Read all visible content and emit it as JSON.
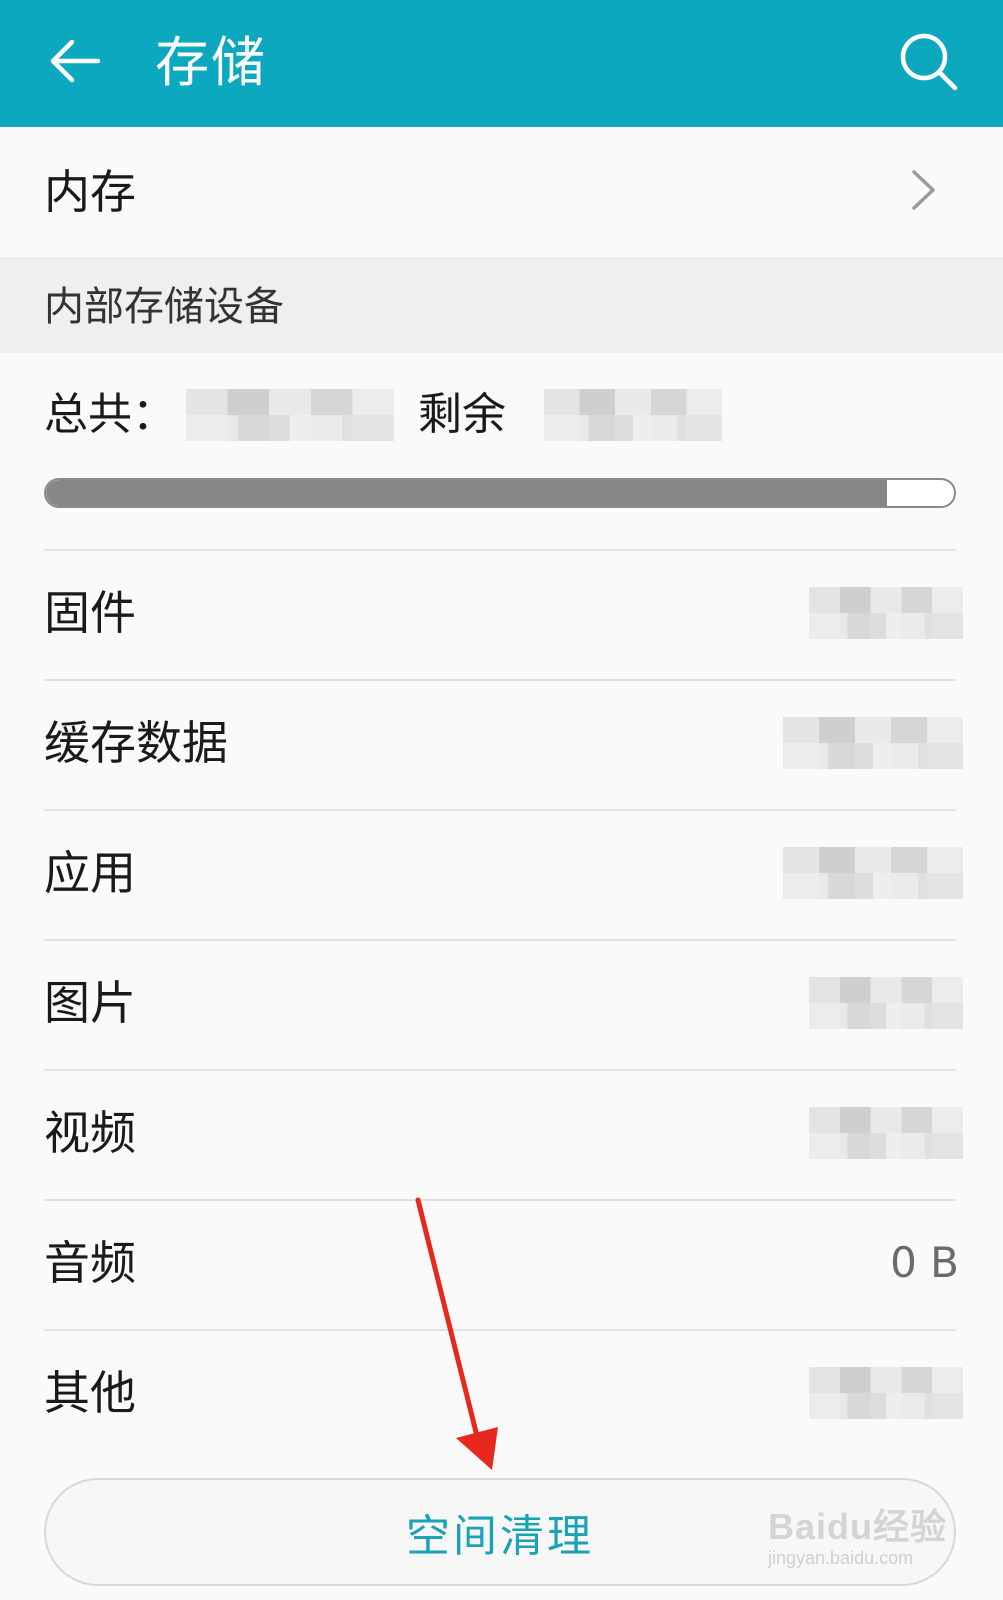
{
  "header": {
    "title": "存储",
    "back_icon": "arrow-left-icon",
    "search_icon": "search-icon",
    "background_color": "#0ca8c0"
  },
  "internal_row": {
    "label": "内存",
    "chevron_icon": "chevron-right-icon"
  },
  "section": {
    "title": "内部存储设备"
  },
  "summary": {
    "total_label": "总共：",
    "remaining_label": "剩余",
    "used_fraction": 0.926
  },
  "items": [
    {
      "name": "固件",
      "size": null
    },
    {
      "name": "缓存数据",
      "size": null
    },
    {
      "name": "应用",
      "size": null
    },
    {
      "name": "图片",
      "size": null
    },
    {
      "name": "视频",
      "size": null
    },
    {
      "name": "音频",
      "size": "0 B"
    },
    {
      "name": "其他",
      "size": null
    }
  ],
  "clean_button": {
    "label": "空间清理",
    "color": "#1aa3b6"
  },
  "watermark": {
    "brand": "Baidu经验",
    "url": "jingyan.baidu.com"
  },
  "annotation_color": "#e8271e"
}
